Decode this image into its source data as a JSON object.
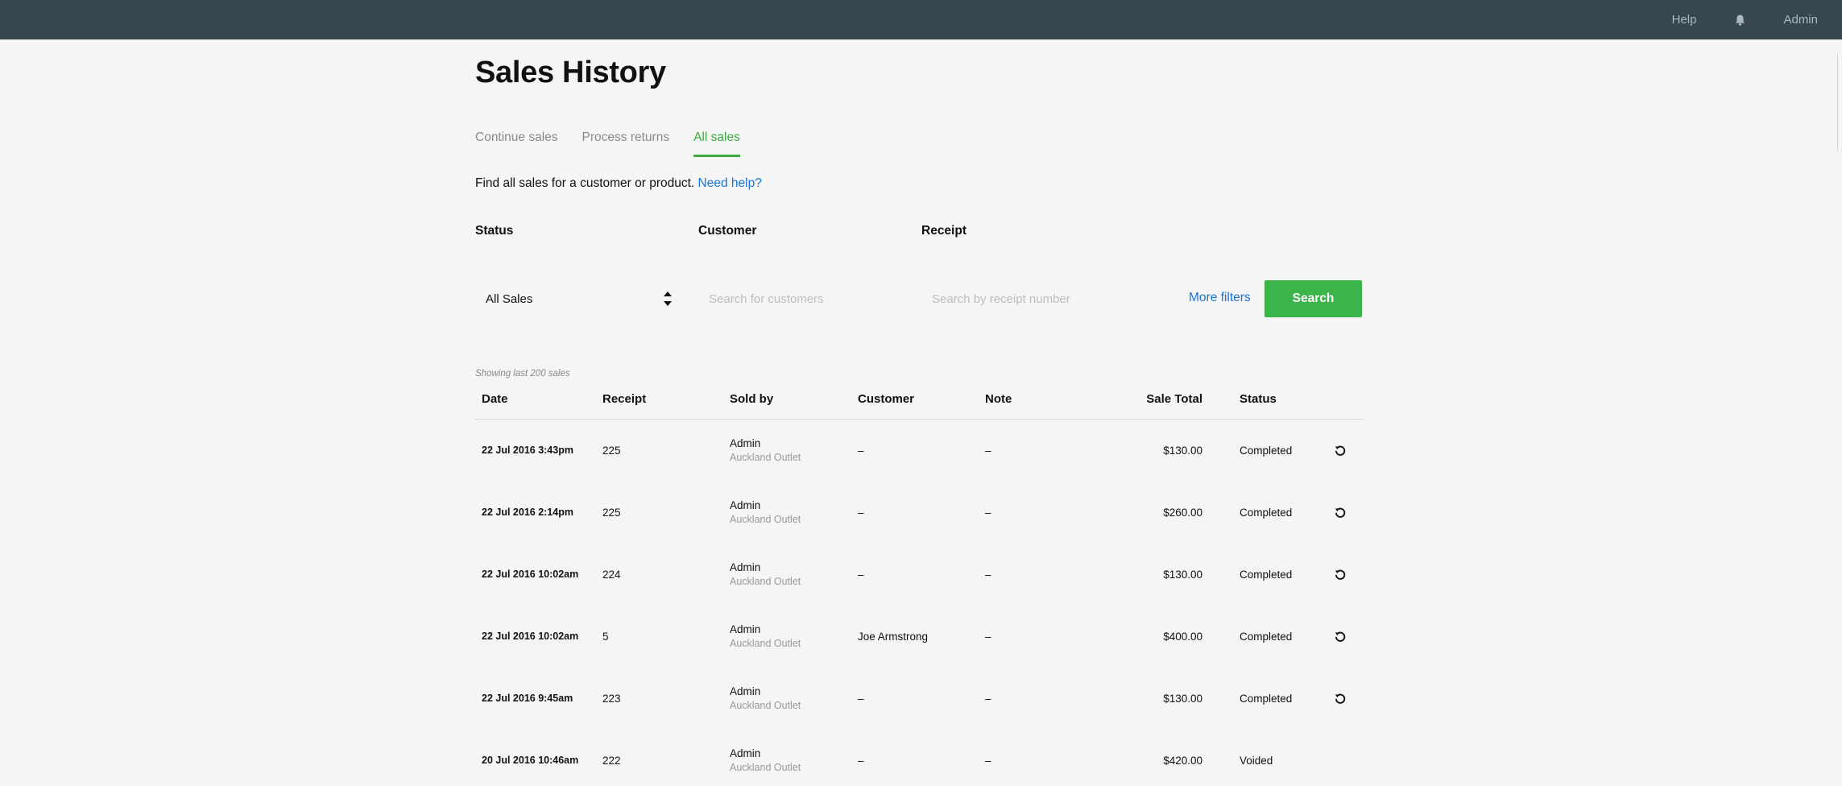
{
  "topbar": {
    "help_label": "Help",
    "bell_icon": "bell-icon",
    "user_label": "Admin",
    "background": "#37474f"
  },
  "page": {
    "title": "Sales History"
  },
  "tabs": [
    {
      "label": "Continue sales",
      "active": false
    },
    {
      "label": "Process returns",
      "active": false
    },
    {
      "label": "All sales",
      "active": true
    }
  ],
  "intro": {
    "text": "Find all sales for a customer or product.",
    "help_link": "Need help?"
  },
  "filters": {
    "status_label": "Status",
    "status_value": "All Sales",
    "customer_label": "Customer",
    "customer_placeholder": "Search for customers",
    "receipt_label": "Receipt",
    "receipt_placeholder": "Search by receipt number",
    "more_filters": "More filters",
    "search_button": "Search"
  },
  "table": {
    "showing_text": "Showing last 200 sales",
    "headers": {
      "date": "Date",
      "receipt": "Receipt",
      "sold_by": "Sold by",
      "customer": "Customer",
      "note": "Note",
      "total": "Sale Total",
      "status": "Status"
    },
    "rows": [
      {
        "date": "22 Jul 2016 3:43pm",
        "receipt": "225",
        "seller": "Admin",
        "outlet": "Auckland Outlet",
        "customer": "–",
        "note": "–",
        "total": "$130.00",
        "status": "Completed",
        "returnable": true
      },
      {
        "date": "22 Jul 2016 2:14pm",
        "receipt": "225",
        "seller": "Admin",
        "outlet": "Auckland Outlet",
        "customer": "–",
        "note": "–",
        "total": "$260.00",
        "status": "Completed",
        "returnable": true
      },
      {
        "date": "22 Jul 2016 10:02am",
        "receipt": "224",
        "seller": "Admin",
        "outlet": "Auckland Outlet",
        "customer": "–",
        "note": "–",
        "total": "$130.00",
        "status": "Completed",
        "returnable": true
      },
      {
        "date": "22 Jul 2016 10:02am",
        "receipt": "5",
        "seller": "Admin",
        "outlet": "Auckland Outlet",
        "customer": "Joe Armstrong",
        "note": "–",
        "total": "$400.00",
        "status": "Completed",
        "returnable": true
      },
      {
        "date": "22 Jul 2016 9:45am",
        "receipt": "223",
        "seller": "Admin",
        "outlet": "Auckland Outlet",
        "customer": "–",
        "note": "–",
        "total": "$130.00",
        "status": "Completed",
        "returnable": true
      },
      {
        "date": "20 Jul 2016 10:46am",
        "receipt": "222",
        "seller": "Admin",
        "outlet": "Auckland Outlet",
        "customer": "–",
        "note": "–",
        "total": "$420.00",
        "status": "Voided",
        "returnable": false
      }
    ]
  },
  "colors": {
    "accent_green": "#3aaa3f",
    "button_green": "#3bb54a",
    "link_blue": "#1a73d6"
  }
}
